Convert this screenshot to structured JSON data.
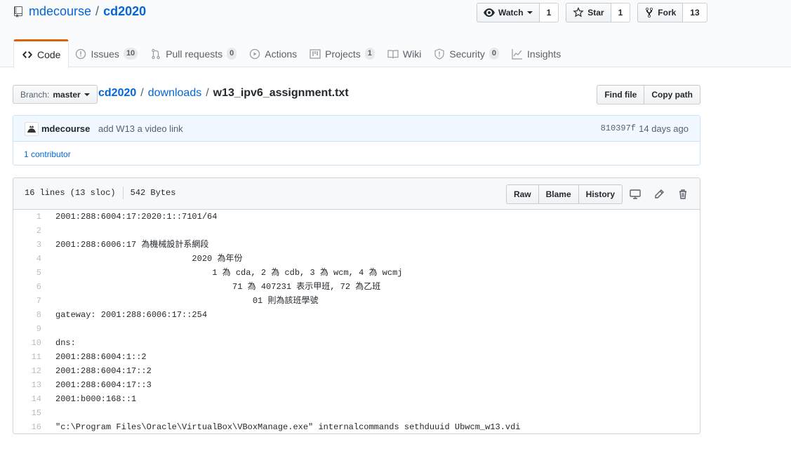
{
  "repo": {
    "owner": "mdecourse",
    "name": "cd2020"
  },
  "actions": {
    "watch": {
      "label": "Watch",
      "count": "1"
    },
    "star": {
      "label": "Star",
      "count": "1"
    },
    "fork": {
      "label": "Fork",
      "count": "13"
    }
  },
  "nav": {
    "code": "Code",
    "issues": {
      "label": "Issues",
      "count": "10"
    },
    "pulls": {
      "label": "Pull requests",
      "count": "0"
    },
    "actions": "Actions",
    "projects": {
      "label": "Projects",
      "count": "1"
    },
    "wiki": "Wiki",
    "security": {
      "label": "Security",
      "count": "0"
    },
    "insights": "Insights"
  },
  "branch": {
    "label": "Branch:",
    "value": "master"
  },
  "breadcrumb": {
    "root": "cd2020",
    "folder": "downloads",
    "file": "w13_ipv6_assignment.txt",
    "sep": "/"
  },
  "file_buttons": {
    "find": "Find file",
    "copy": "Copy path"
  },
  "commit": {
    "author": "mdecourse",
    "message": "add W13 a video link",
    "sha": "810397f",
    "time": "14 days ago",
    "contributors": "1 contributor"
  },
  "file": {
    "lines_info": "16 lines (13 sloc)",
    "size": "542 Bytes",
    "raw": "Raw",
    "blame": "Blame",
    "history": "History"
  },
  "code": [
    {
      "n": "1",
      "text": "2001:288:6004:17:2020:1::7101/64"
    },
    {
      "n": "2",
      "text": ""
    },
    {
      "n": "3",
      "text": "2001:288:6006:17 為機械設計系網段"
    },
    {
      "n": "4",
      "text": "                           2020 為年份"
    },
    {
      "n": "5",
      "text": "                               1 為 cda, 2 為 cdb, 3 為 wcm, 4 為 wcmj"
    },
    {
      "n": "6",
      "text": "                                   71 為 407231 表示甲班, 72 為乙班"
    },
    {
      "n": "7",
      "text": "                                       01 則為該班學號"
    },
    {
      "n": "8",
      "text": "gateway: 2001:288:6006:17::254"
    },
    {
      "n": "9",
      "text": ""
    },
    {
      "n": "10",
      "text": "dns:"
    },
    {
      "n": "11",
      "text": "2001:288:6004:1::2"
    },
    {
      "n": "12",
      "text": "2001:288:6004:17::2"
    },
    {
      "n": "13",
      "text": "2001:288:6004:17::3"
    },
    {
      "n": "14",
      "text": "2001:b000:168::1"
    },
    {
      "n": "15",
      "text": ""
    },
    {
      "n": "16",
      "text": "\"c:\\Program Files\\Oracle\\VirtualBox\\VBoxManage.exe\" internalcommands sethduuid Ubwcm_w13.vdi"
    }
  ],
  "colors": {
    "accent": "#0366d6",
    "tab_border": "#e36209",
    "commit_bg": "#f1f8ff"
  }
}
